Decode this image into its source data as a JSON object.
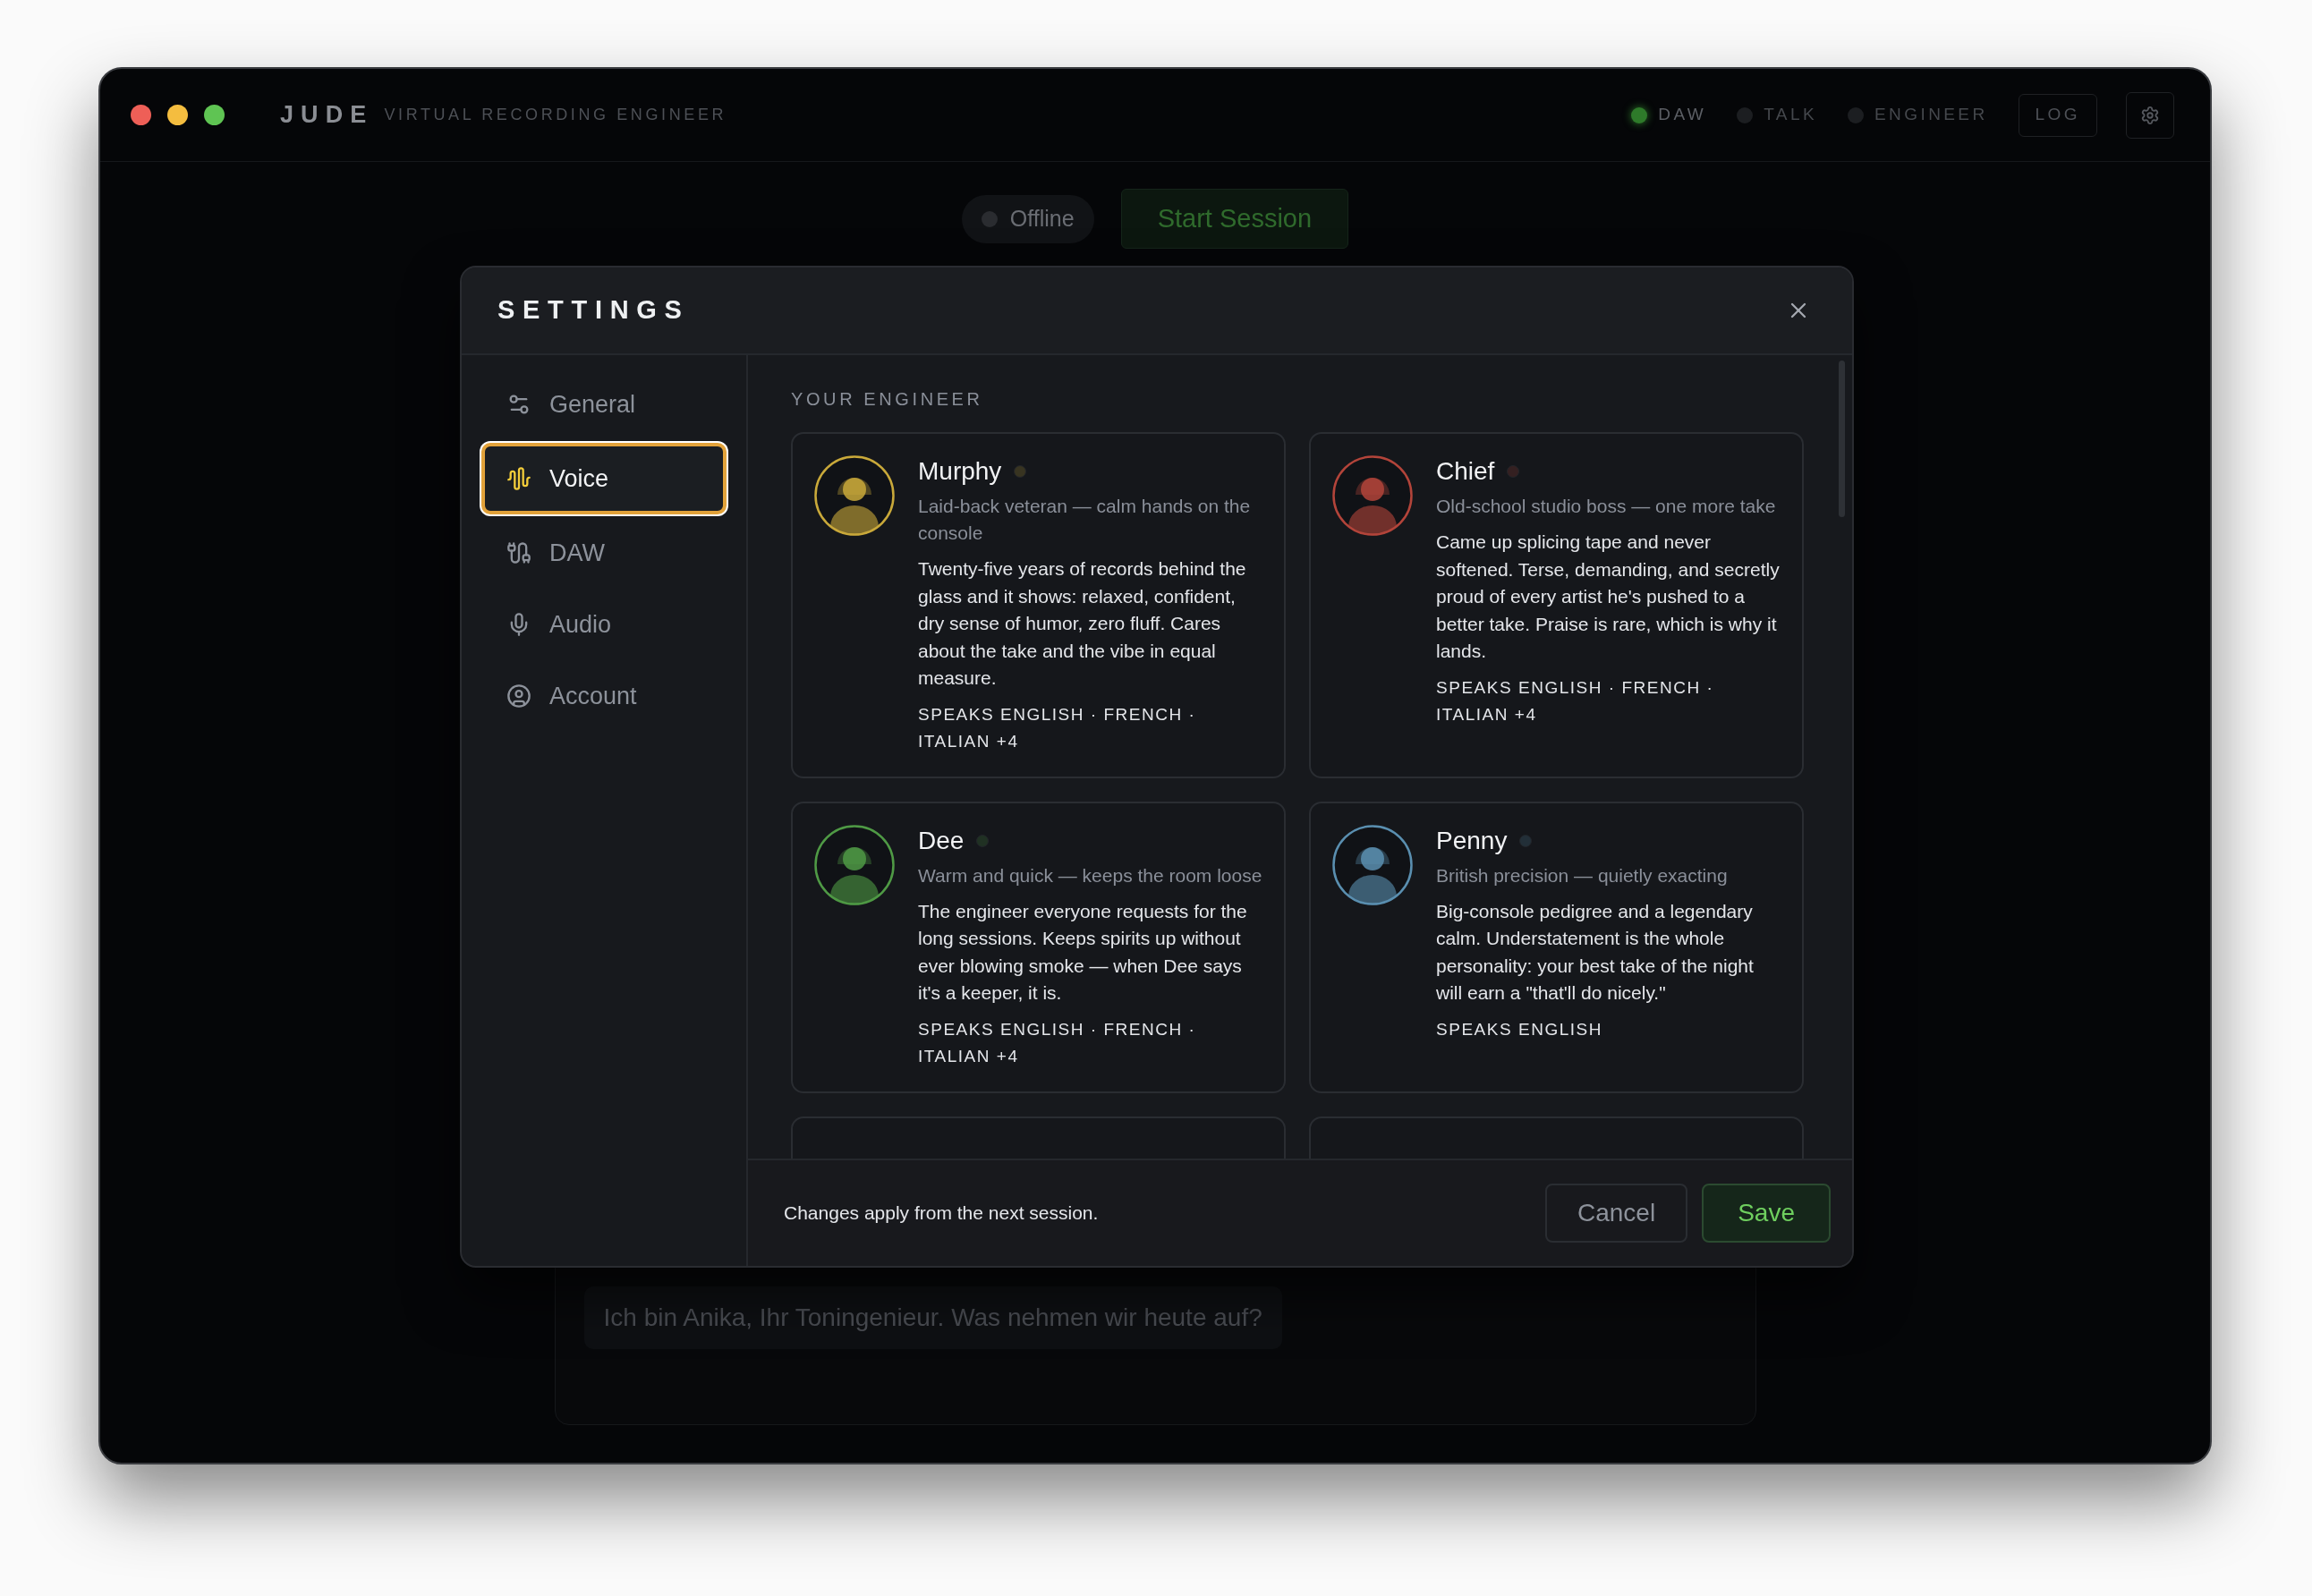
{
  "app": {
    "brand": "JUDE",
    "subtitle": "VIRTUAL RECORDING ENGINEER",
    "indicators": [
      {
        "label": "DAW",
        "on": true
      },
      {
        "label": "TALK",
        "on": false
      },
      {
        "label": "ENGINEER",
        "on": false
      }
    ],
    "log_button": "LOG"
  },
  "session": {
    "status": "Offline",
    "start_button": "Start Session"
  },
  "chat": {
    "message": "Ich bin Anika, Ihr Toningenieur. Was nehmen wir heute auf?"
  },
  "settings": {
    "title": "SETTINGS",
    "nav": [
      {
        "label": "General",
        "kind": "general",
        "selected": false
      },
      {
        "label": "Voice",
        "kind": "voice",
        "selected": true
      },
      {
        "label": "DAW",
        "kind": "daw",
        "selected": false
      },
      {
        "label": "Audio",
        "kind": "audio",
        "selected": false
      },
      {
        "label": "Account",
        "kind": "account",
        "selected": false
      }
    ],
    "section_title": "YOUR ENGINEER",
    "engineers": [
      {
        "name": "Murphy",
        "color": "#c9a93a",
        "tagline": "Laid-back veteran — calm hands on the console",
        "description": "Twenty-five years of records behind the glass and it shows: relaxed, confident, dry sense of humor, zero fluff. Cares about the take and the vibe in equal measure.",
        "languages": "SPEAKS ENGLISH · FRENCH · ITALIAN +4"
      },
      {
        "name": "Chief",
        "color": "#b3443a",
        "tagline": "Old-school studio boss — one more take",
        "description": "Came up splicing tape and never softened. Terse, demanding, and secretly proud of every artist he's pushed to a better take. Praise is rare, which is why it lands.",
        "languages": "SPEAKS ENGLISH · FRENCH · ITALIAN +4"
      },
      {
        "name": "Dee",
        "color": "#4f9a45",
        "tagline": "Warm and quick — keeps the room loose",
        "description": "The engineer everyone requests for the long sessions. Keeps spirits up without ever blowing smoke — when Dee says it's a keeper, it is.",
        "languages": "SPEAKS ENGLISH · FRENCH · ITALIAN +4"
      },
      {
        "name": "Penny",
        "color": "#5a8fb0",
        "tagline": "British precision — quietly exacting",
        "description": "Big-console pedigree and a legendary calm. Understatement is the whole personality: your best take of the night will earn a \"that'll do nicely.\"",
        "languages": "SPEAKS ENGLISH"
      }
    ],
    "footer_note": "Changes apply from the next session.",
    "cancel": "Cancel",
    "save": "Save"
  }
}
